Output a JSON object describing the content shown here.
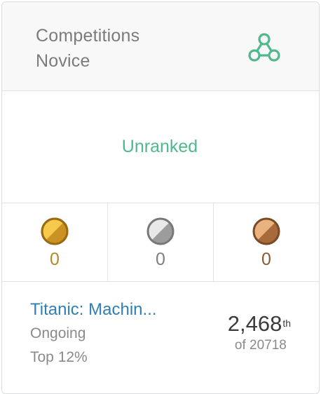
{
  "header": {
    "title_line1": "Competitions",
    "title_line2": "Novice",
    "tier_icon": "tier-network-icon",
    "accent": "#4fb98c"
  },
  "rank": {
    "label": "Unranked",
    "color": "#4fb98c"
  },
  "medals": [
    {
      "type": "gold",
      "count": "0",
      "color": "#b38a2b"
    },
    {
      "type": "silver",
      "count": "0",
      "color": "#7f7f7f"
    },
    {
      "type": "bronze",
      "count": "0",
      "color": "#8a5a30"
    }
  ],
  "competition": {
    "name": "Titanic: Machin...",
    "status": "Ongoing",
    "top": "Top 12%",
    "rank_number": "2,468",
    "rank_suffix": "th",
    "rank_of": "of 20718"
  }
}
